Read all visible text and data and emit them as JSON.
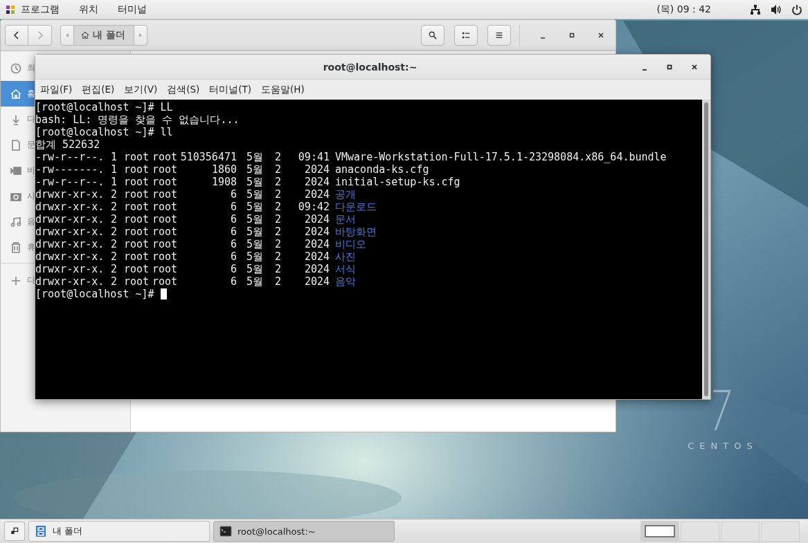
{
  "top_bar": {
    "menus": [
      {
        "label": "프로그램"
      },
      {
        "label": "위치"
      },
      {
        "label": "터미널"
      }
    ],
    "clock": "(목) 09 : 42"
  },
  "file_manager": {
    "path": "내 폴더",
    "sidebar": [
      {
        "label": "최",
        "selected": false,
        "kind": "recent"
      },
      {
        "label": "홈",
        "selected": true,
        "kind": "home"
      },
      {
        "label": "다",
        "selected": false,
        "kind": "download"
      },
      {
        "label": "문",
        "selected": false,
        "kind": "document"
      },
      {
        "label": "비",
        "selected": false,
        "kind": "video"
      },
      {
        "label": "사",
        "selected": false,
        "kind": "camera"
      },
      {
        "label": "음",
        "selected": false,
        "kind": "music"
      },
      {
        "label": "휴",
        "selected": false,
        "kind": "trash"
      },
      {
        "label": "다",
        "selected": false,
        "kind": "other"
      }
    ]
  },
  "terminal": {
    "title": "root@localhost:~",
    "menus": [
      {
        "label": "파일(F)"
      },
      {
        "label": "편집(E)"
      },
      {
        "label": "보기(V)"
      },
      {
        "label": "검색(S)"
      },
      {
        "label": "터미널(T)"
      },
      {
        "label": "도움말(H)"
      }
    ],
    "lines": [
      {
        "kind": "prompt",
        "prompt": "[root@localhost ~]#",
        "command": "LL"
      },
      {
        "kind": "text",
        "text": "bash: LL: 명령을 찾을 수 없습니다..."
      },
      {
        "kind": "prompt",
        "prompt": "[root@localhost ~]#",
        "command": "ll"
      },
      {
        "kind": "text",
        "text": "합계 522632"
      },
      {
        "kind": "file",
        "perms": "-rw-r--r--.",
        "links": "1",
        "owner": "root",
        "group": "root",
        "size": "510356471",
        "month": "5월",
        "day": "2",
        "time": "09:41",
        "name": "VMware-Workstation-Full-17.5.1-23298084.x86_64.bundle"
      },
      {
        "kind": "file",
        "perms": "-rw-------.",
        "links": "1",
        "owner": "root",
        "group": "root",
        "size": "1860",
        "month": "5월",
        "day": "2",
        "time": "2024",
        "name": "anaconda-ks.cfg"
      },
      {
        "kind": "file",
        "perms": "-rw-r--r--.",
        "links": "1",
        "owner": "root",
        "group": "root",
        "size": "1908",
        "month": "5월",
        "day": "2",
        "time": "2024",
        "name": "initial-setup-ks.cfg"
      },
      {
        "kind": "dir",
        "perms": "drwxr-xr-x.",
        "links": "2",
        "owner": "root",
        "group": "root",
        "size": "6",
        "month": "5월",
        "day": "2",
        "time": "2024",
        "name": "공개"
      },
      {
        "kind": "dir",
        "perms": "drwxr-xr-x.",
        "links": "2",
        "owner": "root",
        "group": "root",
        "size": "6",
        "month": "5월",
        "day": "2",
        "time": "09:42",
        "name": "다운로드"
      },
      {
        "kind": "dir",
        "perms": "drwxr-xr-x.",
        "links": "2",
        "owner": "root",
        "group": "root",
        "size": "6",
        "month": "5월",
        "day": "2",
        "time": "2024",
        "name": "문서"
      },
      {
        "kind": "dir",
        "perms": "drwxr-xr-x.",
        "links": "2",
        "owner": "root",
        "group": "root",
        "size": "6",
        "month": "5월",
        "day": "2",
        "time": "2024",
        "name": "바탕화면"
      },
      {
        "kind": "dir",
        "perms": "drwxr-xr-x.",
        "links": "2",
        "owner": "root",
        "group": "root",
        "size": "6",
        "month": "5월",
        "day": "2",
        "time": "2024",
        "name": "비디오"
      },
      {
        "kind": "dir",
        "perms": "drwxr-xr-x.",
        "links": "2",
        "owner": "root",
        "group": "root",
        "size": "6",
        "month": "5월",
        "day": "2",
        "time": "2024",
        "name": "사진"
      },
      {
        "kind": "dir",
        "perms": "drwxr-xr-x.",
        "links": "2",
        "owner": "root",
        "group": "root",
        "size": "6",
        "month": "5월",
        "day": "2",
        "time": "2024",
        "name": "서식"
      },
      {
        "kind": "dir",
        "perms": "drwxr-xr-x.",
        "links": "2",
        "owner": "root",
        "group": "root",
        "size": "6",
        "month": "5월",
        "day": "2",
        "time": "2024",
        "name": "음악"
      },
      {
        "kind": "prompt",
        "prompt": "[root@localhost ~]#"
      }
    ],
    "cursor": true
  },
  "desktop_logo": {
    "numeral": "7",
    "name": "CENTOS"
  },
  "taskbar": {
    "tasks": [
      {
        "label": "내 폴더",
        "selected": false,
        "kind": "files"
      },
      {
        "label": "root@localhost:~",
        "selected": true,
        "kind": "terminal"
      }
    ],
    "workspaces": [
      {
        "selected": true
      },
      {
        "selected": false
      },
      {
        "selected": false
      },
      {
        "selected": false
      }
    ]
  }
}
